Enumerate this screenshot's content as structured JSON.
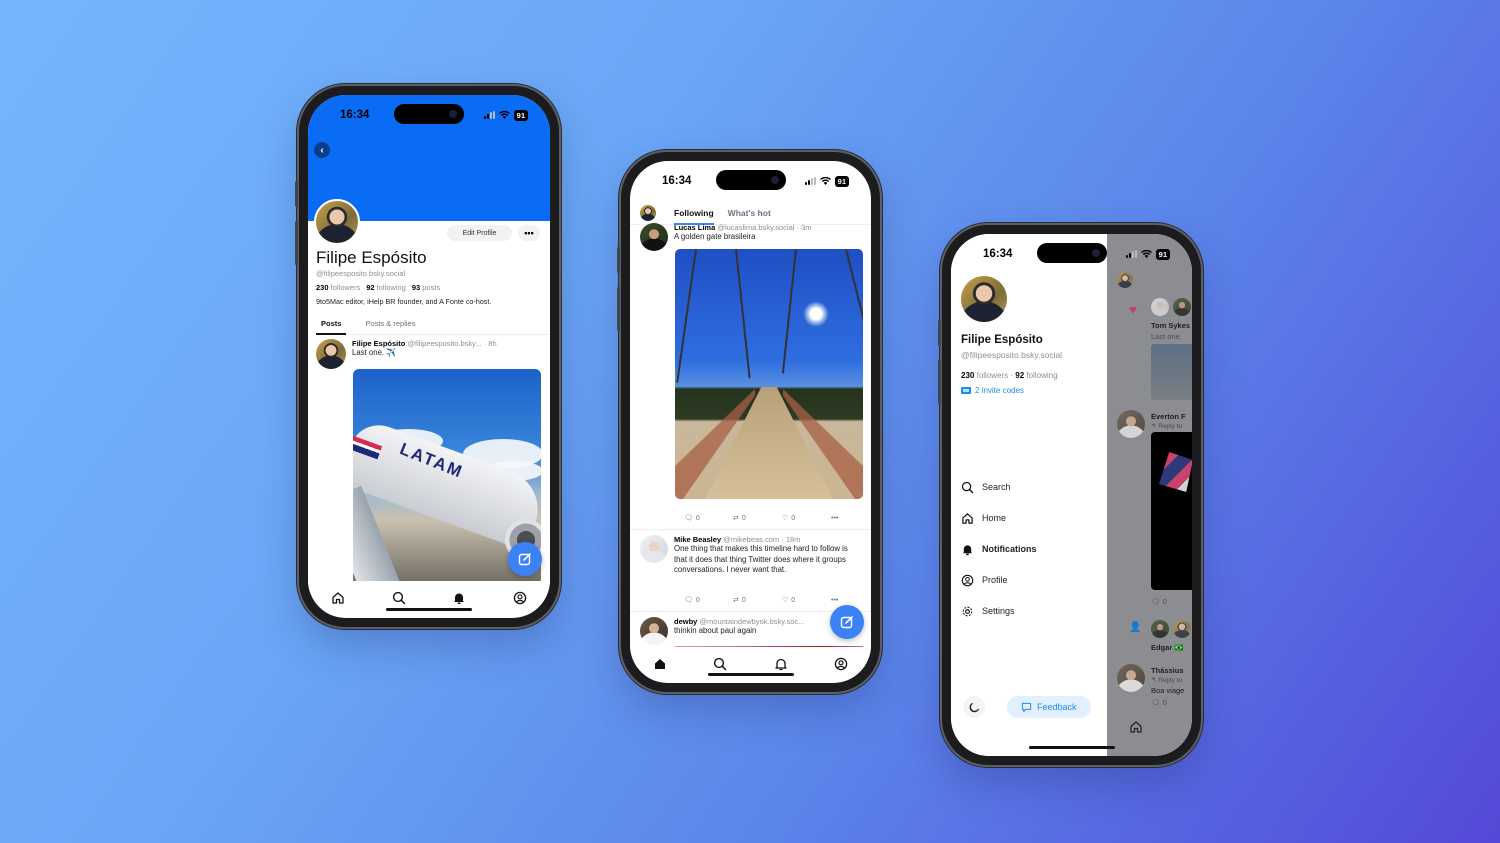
{
  "colors": {
    "accent": "#3b82f6",
    "banner": "#0a6cf5",
    "link": "#1d8cf0",
    "like": "#e8438b"
  },
  "status_bar": {
    "time": "16:34",
    "battery": "91"
  },
  "profile_screen": {
    "back_icon": "chevron-left-icon",
    "edit_profile_label": "Edit Profile",
    "more_label": "•••",
    "display_name": "Filipe Espósito",
    "handle": "@filipeesposito.bsky.social",
    "stats": {
      "followers_count": "230",
      "followers_label": "followers",
      "following_count": "92",
      "following_label": "following",
      "posts_count": "93",
      "posts_label": "posts"
    },
    "bio": "9to5Mac editor, iHelp BR founder, and A Fonte co-host.",
    "tabs": [
      {
        "label": "Posts",
        "active": true
      },
      {
        "label": "Posts & replies",
        "active": false
      }
    ],
    "post": {
      "author": "Filipe Espósito",
      "handle": "@filipeesposito.bsky...",
      "time": "· 8h",
      "text": "Last one. ✈️",
      "image_alt": "LATAM airplane on the tarmac",
      "image_label": "LATAM"
    },
    "nav": [
      "home-icon",
      "search-icon",
      "bell-icon",
      "profile-icon"
    ],
    "active_nav": "bell-icon"
  },
  "feed_screen": {
    "tabs": [
      {
        "label": "Following",
        "active": true
      },
      {
        "label": "What's hot",
        "active": false
      }
    ],
    "posts": [
      {
        "author": "Lucas Lima",
        "handle": "@lucaslima.bsky.social",
        "time": "· 3m",
        "text": "A golden gate brasileira",
        "image_alt": "Suspension footbridge under a blue sky",
        "replies": "0",
        "reposts": "0",
        "likes": "0"
      },
      {
        "author": "Mike Beasley",
        "handle": "@mikebeas.com",
        "time": "· 18m",
        "text": "One thing that makes this timeline hard to follow is that it does that thing Twitter does where it groups conversations. I never want that.",
        "replies": "0",
        "reposts": "0",
        "likes": "0"
      },
      {
        "author": "dewby",
        "handle": "@mountaindewbyok.bsky.soc...",
        "text": "thinkin about paul again"
      }
    ],
    "more_label": "•••",
    "nav": [
      "home-icon",
      "search-icon",
      "bell-icon",
      "profile-icon"
    ],
    "active_nav": "home-icon"
  },
  "drawer_screen": {
    "display_name": "Filipe Espósito",
    "handle": "@filipeesposito.bsky.social",
    "followers_count": "230",
    "followers_label": "followers ·",
    "following_count": "92",
    "following_label": "following",
    "invite_codes": "2 invite codes",
    "menu": [
      {
        "label": "Search",
        "icon": "search-icon",
        "active": false
      },
      {
        "label": "Home",
        "icon": "home-icon",
        "active": false
      },
      {
        "label": "Notifications",
        "icon": "bell-icon",
        "active": true
      },
      {
        "label": "Profile",
        "icon": "profile-icon",
        "active": false
      },
      {
        "label": "Settings",
        "icon": "gear-icon",
        "active": false
      }
    ],
    "theme_icon": "moon-icon",
    "feedback_label": "Feedback",
    "behind": {
      "notif1_name": "Tom Sykes",
      "notif1_text": "Last one.",
      "notif2_name": "Everton F",
      "notif2_sub": "↰ Reply to",
      "reply_count_1": "0",
      "notif3_name": "Edgar 🇧🇷",
      "notif4_name": "Thássius",
      "notif4_sub": "↰ Reply to",
      "notif4_text": "Boa viage",
      "reply_count_2": "0"
    }
  }
}
